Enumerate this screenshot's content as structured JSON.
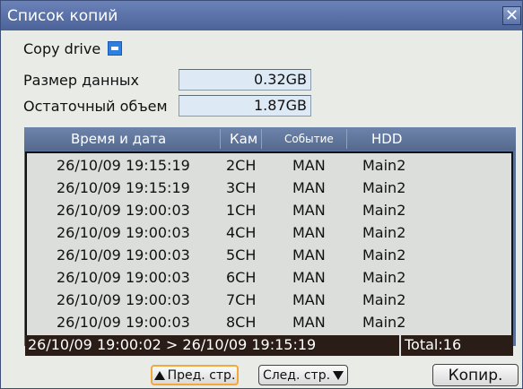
{
  "window": {
    "title": "Список копий"
  },
  "copy_drive": {
    "label": "Copy drive",
    "icon": "drive-icon"
  },
  "fields": {
    "data_size_label": "Размер данных",
    "data_size_value": "0.32GB",
    "remaining_label": "Остаточный объем",
    "remaining_value": "1.87GB"
  },
  "table": {
    "columns": [
      "Время и дата",
      "Кам",
      "Событие",
      "HDD"
    ],
    "rows": [
      [
        "26/10/09 19:15:19",
        "2CH",
        "MAN",
        "Main2"
      ],
      [
        "26/10/09 19:15:19",
        "3CH",
        "MAN",
        "Main2"
      ],
      [
        "26/10/09 19:00:03",
        "1CH",
        "MAN",
        "Main2"
      ],
      [
        "26/10/09 19:00:03",
        "4CH",
        "MAN",
        "Main2"
      ],
      [
        "26/10/09 19:00:03",
        "5CH",
        "MAN",
        "Main2"
      ],
      [
        "26/10/09 19:00:03",
        "6CH",
        "MAN",
        "Main2"
      ],
      [
        "26/10/09 19:00:03",
        "7CH",
        "MAN",
        "Main2"
      ],
      [
        "26/10/09 19:00:03",
        "8CH",
        "MAN",
        "Main2"
      ]
    ]
  },
  "status": {
    "range": "26/10/09 19:00:02 > 26/10/09 19:15:19",
    "total": "Total:16"
  },
  "buttons": {
    "prev": "Пред. стр.",
    "next": "След. стр.",
    "copy": "Копир."
  }
}
